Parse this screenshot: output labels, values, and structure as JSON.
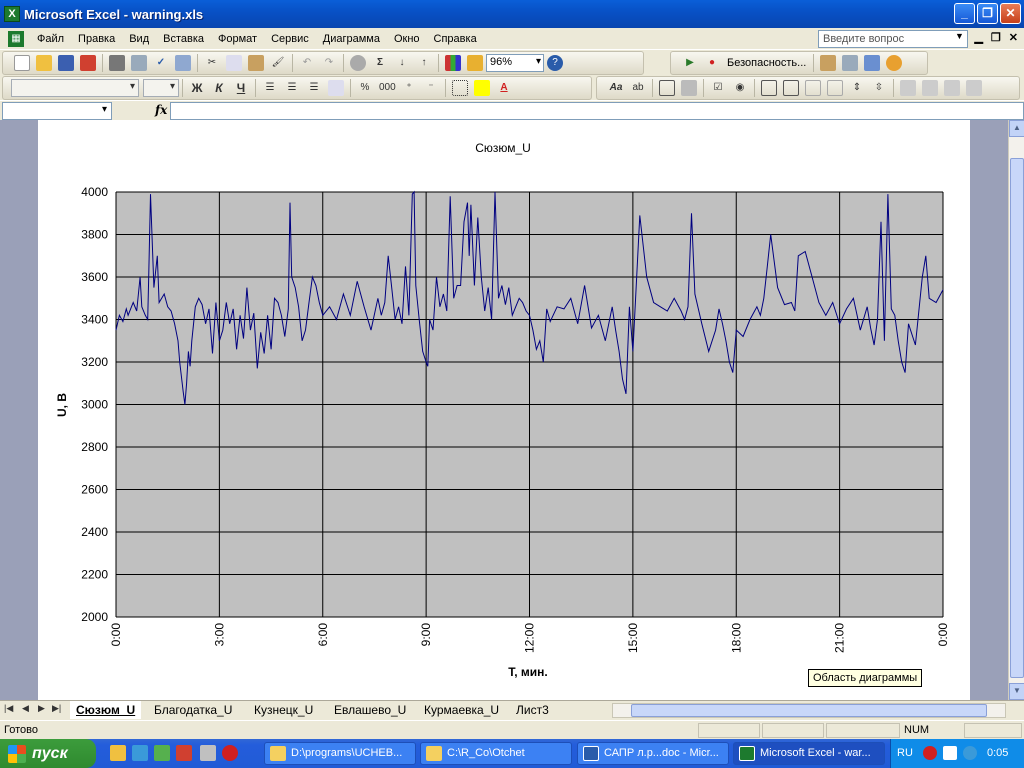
{
  "window": {
    "title": "Microsoft Excel - warning.xls",
    "app_icon": "X"
  },
  "menu": {
    "items": [
      "Файл",
      "Правка",
      "Вид",
      "Вставка",
      "Формат",
      "Сервис",
      "Диаграмма",
      "Окно",
      "Справка"
    ],
    "ask_placeholder": "Введите вопрос"
  },
  "toolbar": {
    "zoom": "96%",
    "security": "Безопасность..."
  },
  "formatting": {
    "bold": "Ж",
    "italic": "К",
    "underline": "Ч"
  },
  "formula": {
    "fx": "fx"
  },
  "chart_data": {
    "type": "line",
    "title": "Сюзюм_U",
    "xlabel": "T, мин.",
    "ylabel": "U, В",
    "ylim": [
      2000,
      4000
    ],
    "yticks": [
      "2000",
      "2200",
      "2400",
      "2600",
      "2800",
      "3000",
      "3200",
      "3400",
      "3600",
      "3800",
      "4000"
    ],
    "xticks": [
      "0:00",
      "3:00",
      "6:00",
      "9:00",
      "12:00",
      "15:00",
      "18:00",
      "21:00",
      "0:00"
    ],
    "grid": true,
    "plot_background": "#c0c0c0",
    "line_color": "#000080",
    "x_hours": [
      0,
      0.1,
      0.2,
      0.3,
      0.35,
      0.5,
      0.6,
      0.7,
      0.75,
      0.85,
      0.92,
      0.95,
      1.0,
      1.1,
      1.2,
      1.25,
      1.4,
      1.5,
      1.6,
      1.7,
      1.8,
      1.85,
      1.95,
      2.0,
      2.05,
      2.1,
      2.15,
      2.2,
      2.3,
      2.4,
      2.5,
      2.6,
      2.7,
      2.8,
      2.9,
      3.0,
      3.1,
      3.2,
      3.3,
      3.4,
      3.5,
      3.6,
      3.7,
      3.8,
      3.9,
      4.0,
      4.1,
      4.2,
      4.3,
      4.4,
      4.5,
      4.6,
      4.7,
      4.8,
      4.9,
      5.0,
      5.05,
      5.1,
      5.2,
      5.3,
      5.4,
      5.5,
      5.6,
      5.7,
      5.8,
      5.9,
      6.0,
      6.2,
      6.4,
      6.6,
      6.8,
      7.0,
      7.2,
      7.4,
      7.6,
      7.7,
      7.8,
      7.9,
      8.0,
      8.1,
      8.2,
      8.3,
      8.4,
      8.5,
      8.6,
      8.65,
      8.7,
      8.8,
      8.9,
      9.0,
      9.05,
      9.1,
      9.2,
      9.3,
      9.4,
      9.5,
      9.6,
      9.7,
      9.8,
      9.9,
      10.0,
      10.1,
      10.2,
      10.25,
      10.3,
      10.4,
      10.5,
      10.6,
      10.7,
      10.8,
      10.9,
      11.0,
      11.1,
      11.2,
      11.3,
      11.4,
      11.5,
      11.6,
      11.7,
      11.8,
      11.9,
      12.0,
      12.1,
      12.2,
      12.3,
      12.4,
      12.5,
      12.6,
      12.8,
      13.0,
      13.2,
      13.4,
      13.6,
      13.8,
      14.0,
      14.2,
      14.4,
      14.5,
      14.6,
      14.7,
      14.8,
      14.9,
      15.0,
      15.2,
      15.4,
      15.6,
      15.8,
      16.0,
      16.2,
      16.4,
      16.5,
      16.6,
      16.7,
      16.8,
      17.0,
      17.2,
      17.4,
      17.5,
      17.6,
      17.7,
      17.8,
      17.9,
      18.0,
      18.2,
      18.4,
      18.6,
      18.7,
      18.8,
      18.9,
      19.0,
      19.2,
      19.4,
      19.6,
      19.7,
      19.8,
      20.0,
      20.2,
      20.4,
      20.6,
      20.8,
      21.0,
      21.2,
      21.4,
      21.6,
      21.8,
      21.9,
      22.0,
      22.1,
      22.2,
      22.3,
      22.4,
      22.5,
      22.6,
      22.7,
      22.8,
      22.9,
      23.0,
      23.2,
      23.4,
      23.5,
      23.6,
      23.8,
      24.0
    ],
    "values": [
      3350,
      3420,
      3390,
      3450,
      3420,
      3480,
      3440,
      3600,
      3460,
      3420,
      3400,
      3600,
      3990,
      3550,
      3700,
      3480,
      3520,
      3460,
      3440,
      3380,
      3300,
      3200,
      3060,
      3000,
      3100,
      3250,
      3180,
      3300,
      3460,
      3500,
      3470,
      3380,
      3450,
      3240,
      3480,
      3300,
      3350,
      3480,
      3380,
      3450,
      3260,
      3420,
      3310,
      3550,
      3350,
      3430,
      3170,
      3340,
      3240,
      3420,
      3260,
      3500,
      3480,
      3420,
      3320,
      3450,
      3950,
      3600,
      3550,
      3460,
      3300,
      3350,
      3480,
      3600,
      3560,
      3480,
      3420,
      3460,
      3400,
      3520,
      3420,
      3580,
      3460,
      3350,
      3500,
      3420,
      3480,
      3700,
      3550,
      3400,
      3460,
      3380,
      3650,
      3420,
      3990,
      4000,
      3560,
      3400,
      3250,
      3200,
      3180,
      3400,
      3350,
      3600,
      3460,
      3520,
      3440,
      3980,
      3500,
      3560,
      3560,
      3860,
      3950,
      3700,
      3940,
      3560,
      3880,
      3600,
      3440,
      3550,
      3400,
      4000,
      3500,
      3560,
      3470,
      3550,
      3420,
      3460,
      3500,
      3480,
      3440,
      3420,
      3350,
      3260,
      3300,
      3200,
      3450,
      3390,
      3460,
      3450,
      3500,
      3380,
      3560,
      3360,
      3420,
      3300,
      3460,
      3350,
      3250,
      3120,
      3050,
      3460,
      3250,
      3890,
      3600,
      3480,
      3460,
      3440,
      3500,
      3440,
      3400,
      3460,
      3900,
      3520,
      3380,
      3250,
      3350,
      3450,
      3380,
      3300,
      3200,
      3150,
      3350,
      3320,
      3400,
      3460,
      3420,
      3500,
      3650,
      3800,
      3550,
      3470,
      3480,
      3440,
      3700,
      3720,
      3600,
      3480,
      3420,
      3480,
      3380,
      3450,
      3500,
      3350,
      3460,
      3360,
      3280,
      3400,
      3860,
      3300,
      3990,
      3450,
      3420,
      3300,
      3200,
      3150,
      3380,
      3280,
      3600,
      3700,
      3500,
      3480,
      3540,
      3520
    ]
  },
  "tooltip": "Область диаграммы",
  "sheets": [
    "Сюзюм_U",
    "Благодатка_U",
    "Кузнецк_U",
    "Евлашево_U",
    "Курмаевка_U",
    "Лист3"
  ],
  "status": {
    "ready": "Готово",
    "num": "NUM"
  },
  "taskbar": {
    "start": "пуск",
    "buttons": [
      "D:\\programs\\UCHEB...",
      "C:\\R_Co\\Otchet",
      "САПР л.р...doc - Micr...",
      "Microsoft Excel - war..."
    ],
    "lang": "RU",
    "clock": "0:05"
  }
}
